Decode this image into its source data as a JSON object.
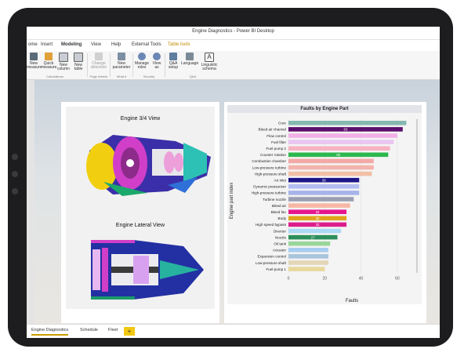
{
  "window": {
    "title": "Engine Diagnostics - Power BI Desktop"
  },
  "menu": {
    "items": [
      {
        "label": "ome"
      },
      {
        "label": "Insert"
      },
      {
        "label": "Modeling"
      },
      {
        "label": "View"
      },
      {
        "label": "Help"
      },
      {
        "label": "External Tools"
      },
      {
        "label": "Table tools"
      }
    ]
  },
  "ribbon": {
    "buttons": [
      {
        "label": "New measure"
      },
      {
        "label": "Quick measure"
      },
      {
        "label": "New column"
      },
      {
        "label": "New table"
      },
      {
        "label": "Change detection"
      },
      {
        "label": "New parameter"
      },
      {
        "label": "Manage roles"
      },
      {
        "label": "View as"
      },
      {
        "label": "Q&A setup"
      },
      {
        "label": "Language"
      },
      {
        "label": "Linguistic schema"
      }
    ],
    "groups": [
      {
        "label": "Calculations"
      },
      {
        "label": "Page refresh"
      },
      {
        "label": "What if"
      },
      {
        "label": "Security"
      },
      {
        "label": "Q&A"
      }
    ]
  },
  "left_panel": {
    "view1_title": "Engine 3/4 View",
    "view2_title": "Engine Lateral View"
  },
  "chart_data": {
    "type": "bar",
    "orientation": "horizontal",
    "title": "Faults by Engine Part",
    "xlabel": "Faults",
    "ylabel": "Engine part index",
    "xlim": [
      0,
      70
    ],
    "xticks": [
      0,
      20,
      40,
      60
    ],
    "grid": true,
    "categories": [
      "Core",
      "Bleed air channel",
      "Flow control",
      "Fuel filter",
      "Fuel pump 2",
      "Counter rotation",
      "Combustion chamber",
      "Low-pressure turbine",
      "High-pressure shaft",
      "Air inlet",
      "Dynamic pressurizer",
      "High-pressure turbine",
      "Turbine nozzle",
      "Bleed air",
      "Bleed fan",
      "Body",
      "High speed bypass",
      "Diverter",
      "Nozzle",
      "Oil tank",
      "Actuator",
      "Expansion control",
      "Low-pressure shaft",
      "Fuel pump 1"
    ],
    "values": [
      65,
      63,
      60,
      58,
      56,
      55,
      47,
      47,
      46,
      39,
      39,
      39,
      36,
      34,
      32,
      32,
      32,
      29,
      27,
      23,
      22,
      22,
      22,
      20
    ],
    "labels": [
      "",
      "63",
      "",
      "",
      "",
      "55",
      "",
      "",
      "",
      "39",
      "",
      "",
      "",
      "",
      "32",
      "32",
      "32",
      "",
      "27",
      "",
      "",
      "",
      "",
      ""
    ],
    "colors": [
      "#86b8b0",
      "#5a0f6b",
      "#f2b2e6",
      "#e9c6f2",
      "#f7b3c3",
      "#2db84e",
      "#f3a9a6",
      "#f4b3ad",
      "#f2c0a6",
      "#1d1689",
      "#b2bdf2",
      "#a7b4ea",
      "#9a9fb3",
      "#f6b8a5",
      "#e6168d",
      "#e1a51c",
      "#dc1c8b",
      "#acd8f3",
      "#2c8f5a",
      "#99d69a",
      "#a7cdf0",
      "#a9c5dc",
      "#e2d6b7",
      "#e8d89c"
    ]
  },
  "tabs": {
    "items": [
      {
        "label": "Engine Diagnostics"
      },
      {
        "label": "Schedule"
      },
      {
        "label": "Fleet"
      }
    ],
    "add_label": "+"
  }
}
